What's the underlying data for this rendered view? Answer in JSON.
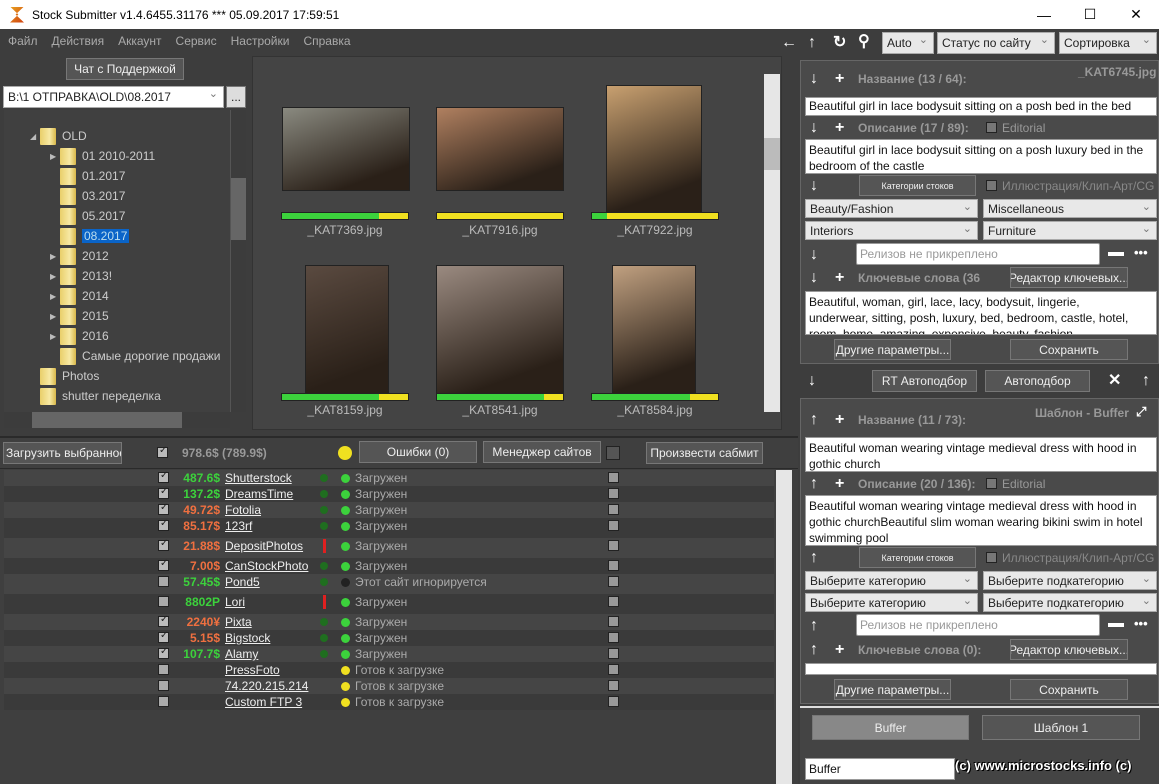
{
  "window": {
    "title": "Stock Submitter v1.4.6455.31176 ***  05.09.2017 17:59:51",
    "minimize": "—",
    "maximize": "☐",
    "close": "✕"
  },
  "menu": [
    "Файл",
    "Действия",
    "Аккаунт",
    "Сервис",
    "Настройки",
    "Справка"
  ],
  "toolbar": {
    "zoom_mode": "Auto",
    "status_filter": "Статус по сайту",
    "sort": "Сортировка"
  },
  "left": {
    "chat_button": "Чат с Поддержкой",
    "path": "B:\\1 ОТПРАВКА\\OLD\\08.2017",
    "browse": "...",
    "tree": [
      {
        "label": "OLD",
        "level": 1,
        "expand": "open"
      },
      {
        "label": "01 2010-2011",
        "level": 2,
        "expand": "closed"
      },
      {
        "label": "01.2017",
        "level": 2
      },
      {
        "label": "03.2017",
        "level": 2
      },
      {
        "label": "05.2017",
        "level": 2
      },
      {
        "label": "08.2017",
        "level": 2,
        "selected": true
      },
      {
        "label": "2012",
        "level": 2,
        "expand": "closed"
      },
      {
        "label": "2013!",
        "level": 2,
        "expand": "closed"
      },
      {
        "label": "2014",
        "level": 2,
        "expand": "closed"
      },
      {
        "label": "2015",
        "level": 2,
        "expand": "closed"
      },
      {
        "label": "2016",
        "level": 2,
        "expand": "closed"
      },
      {
        "label": "Самые дорогие продажи",
        "level": 2
      },
      {
        "label": "Photos",
        "level": 1
      },
      {
        "label": "shutter переделка",
        "level": 1
      }
    ]
  },
  "thumbnails": [
    {
      "name": "_KAT7369.jpg",
      "progress": 77,
      "color": "#8a8a80"
    },
    {
      "name": "_KAT7916.jpg",
      "progress": 0,
      "color": "#b08060"
    },
    {
      "name": "_KAT7922.jpg",
      "progress": 12,
      "color": "#c8a070"
    },
    {
      "name": "_KAT8159.jpg",
      "progress": 77,
      "color": "#5a4a40"
    },
    {
      "name": "_KAT8541.jpg",
      "progress": 85,
      "color": "#9a8a80"
    },
    {
      "name": "_KAT8584.jpg",
      "progress": 78,
      "color": "#c0a080"
    }
  ],
  "submit": {
    "upload_selected": "Загрузить выбранное",
    "total": "978.6$  (789.9$)",
    "errors": "Ошибки (0)",
    "site_manager": "Менеджер сайтов",
    "submit": "Произвести сабмит",
    "sites": [
      {
        "checked": true,
        "amount": "487.6$",
        "amount_color": "#3cd23c",
        "name": "Shutterstock",
        "flag": "ok",
        "status": "Загружен",
        "dot": "#3cd23c"
      },
      {
        "checked": true,
        "amount": "137.2$",
        "amount_color": "#3cd23c",
        "name": "DreamsTime",
        "flag": "ok",
        "status": "Загружен",
        "dot": "#3cd23c"
      },
      {
        "checked": true,
        "amount": "49.72$",
        "amount_color": "#f07040",
        "name": "Fotolia",
        "flag": "ok",
        "status": "Загружен",
        "dot": "#3cd23c"
      },
      {
        "checked": true,
        "amount": "85.17$",
        "amount_color": "#f07040",
        "name": "123rf",
        "flag": "ok",
        "status": "Загружен",
        "dot": "#3cd23c"
      },
      {
        "checked": true,
        "amount": "21.88$",
        "amount_color": "#f07040",
        "name": "DepositPhotos",
        "flag": "warn",
        "status": "Загружен",
        "dot": "#3cd23c"
      },
      {
        "checked": true,
        "amount": "7.00$",
        "amount_color": "#f07040",
        "name": "CanStockPhoto",
        "flag": "ok",
        "status": "Загружен",
        "dot": "#3cd23c"
      },
      {
        "checked": false,
        "amount": "57.45$",
        "amount_color": "#3cd23c",
        "name": "Pond5",
        "flag": "ok",
        "status": "Этот сайт игнорируется",
        "dot": "#222"
      },
      {
        "checked": false,
        "amount": "8802P",
        "amount_color": "#3cd23c",
        "name": "Lori",
        "flag": "warn",
        "status": "Загружен",
        "dot": "#3cd23c"
      },
      {
        "checked": true,
        "amount": "2240¥",
        "amount_color": "#f07040",
        "name": "Pixta",
        "flag": "ok",
        "status": "Загружен",
        "dot": "#3cd23c"
      },
      {
        "checked": true,
        "amount": "5.15$",
        "amount_color": "#f07040",
        "name": "Bigstock",
        "flag": "ok",
        "status": "Загружен",
        "dot": "#3cd23c"
      },
      {
        "checked": true,
        "amount": "107.7$",
        "amount_color": "#3cd23c",
        "name": "Alamy",
        "flag": "ok",
        "status": "Загружен",
        "dot": "#3cd23c"
      },
      {
        "checked": false,
        "amount": "",
        "amount_color": "#3cd23c",
        "name": "PressFoto",
        "flag": "",
        "status": "Готов к загрузке",
        "dot": "#f0e020"
      },
      {
        "checked": false,
        "amount": "",
        "amount_color": "#3cd23c",
        "name": "74.220.215.214",
        "flag": "",
        "status": "Готов к загрузке",
        "dot": "#f0e020"
      },
      {
        "checked": false,
        "amount": "",
        "amount_color": "#3cd23c",
        "name": "Custom FTP 3",
        "flag": "",
        "status": "Готов к загрузке",
        "dot": "#f0e020"
      }
    ]
  },
  "editor": {
    "filename": "_KAT6745.jpg",
    "title_label": "Название (13 / 64):",
    "title": "Beautiful girl in lace bodysuit sitting on a posh bed in the bed",
    "desc_label": "Описание (17 / 89):",
    "editorial": "Editorial",
    "desc": "Beautiful girl in lace bodysuit sitting on a posh luxury bed in the bedroom of the castle",
    "categories_btn": "Категории стоков",
    "illustration": "Иллюстрация/Клип-Арт/CG",
    "cat1": "Beauty/Fashion",
    "cat2": "Miscellaneous",
    "cat3": "Interiors",
    "cat4": "Furniture",
    "releases_placeholder": "Релизов не прикреплено",
    "keywords_label": "Ключевые слова (36",
    "keywords_editor": "Редактор ключевых...",
    "keywords": "Beautiful, woman, girl, lace, lacy, bodysuit, lingerie, underwear, sitting, posh, luxury, bed, bedroom, castle, hotel, room, home, amazing, expensive, beauty, fashion, fashionable, blond, lady",
    "other_params": "Другие параметры...",
    "save": "Сохранить"
  },
  "autofill": {
    "rt": "RT Автоподбор",
    "auto": "Автоподбор"
  },
  "template": {
    "name": "Шаблон - Buffer",
    "title_label": "Название (11 / 73):",
    "title": "Beautiful woman wearing vintage medieval dress with hood in gothic church",
    "desc_label": "Описание (20 / 136):",
    "editorial": "Editorial",
    "desc": "Beautiful woman wearing vintage medieval dress with hood in gothic churchBeautiful slim woman wearing bikini swim in hotel swimming pool",
    "categories_btn": "Категории стоков",
    "illustration": "Иллюстрация/Клип-Арт/CG",
    "cat1": "Выберите категорию",
    "cat2": "Выберите подкатегорию",
    "cat3": "Выберите категорию",
    "cat4": "Выберите подкатегорию",
    "releases_placeholder": "Релизов не прикреплено",
    "keywords_label": "Ключевые слова (0):",
    "keywords_editor": "Редактор ключевых...",
    "other_params": "Другие параметры...",
    "save": "Сохранить"
  },
  "templates": {
    "tab1": "Buffer",
    "tab2": "Шаблон 1",
    "name_value": "Buffer"
  },
  "watermark": "(c) www.microstocks.info (c)"
}
